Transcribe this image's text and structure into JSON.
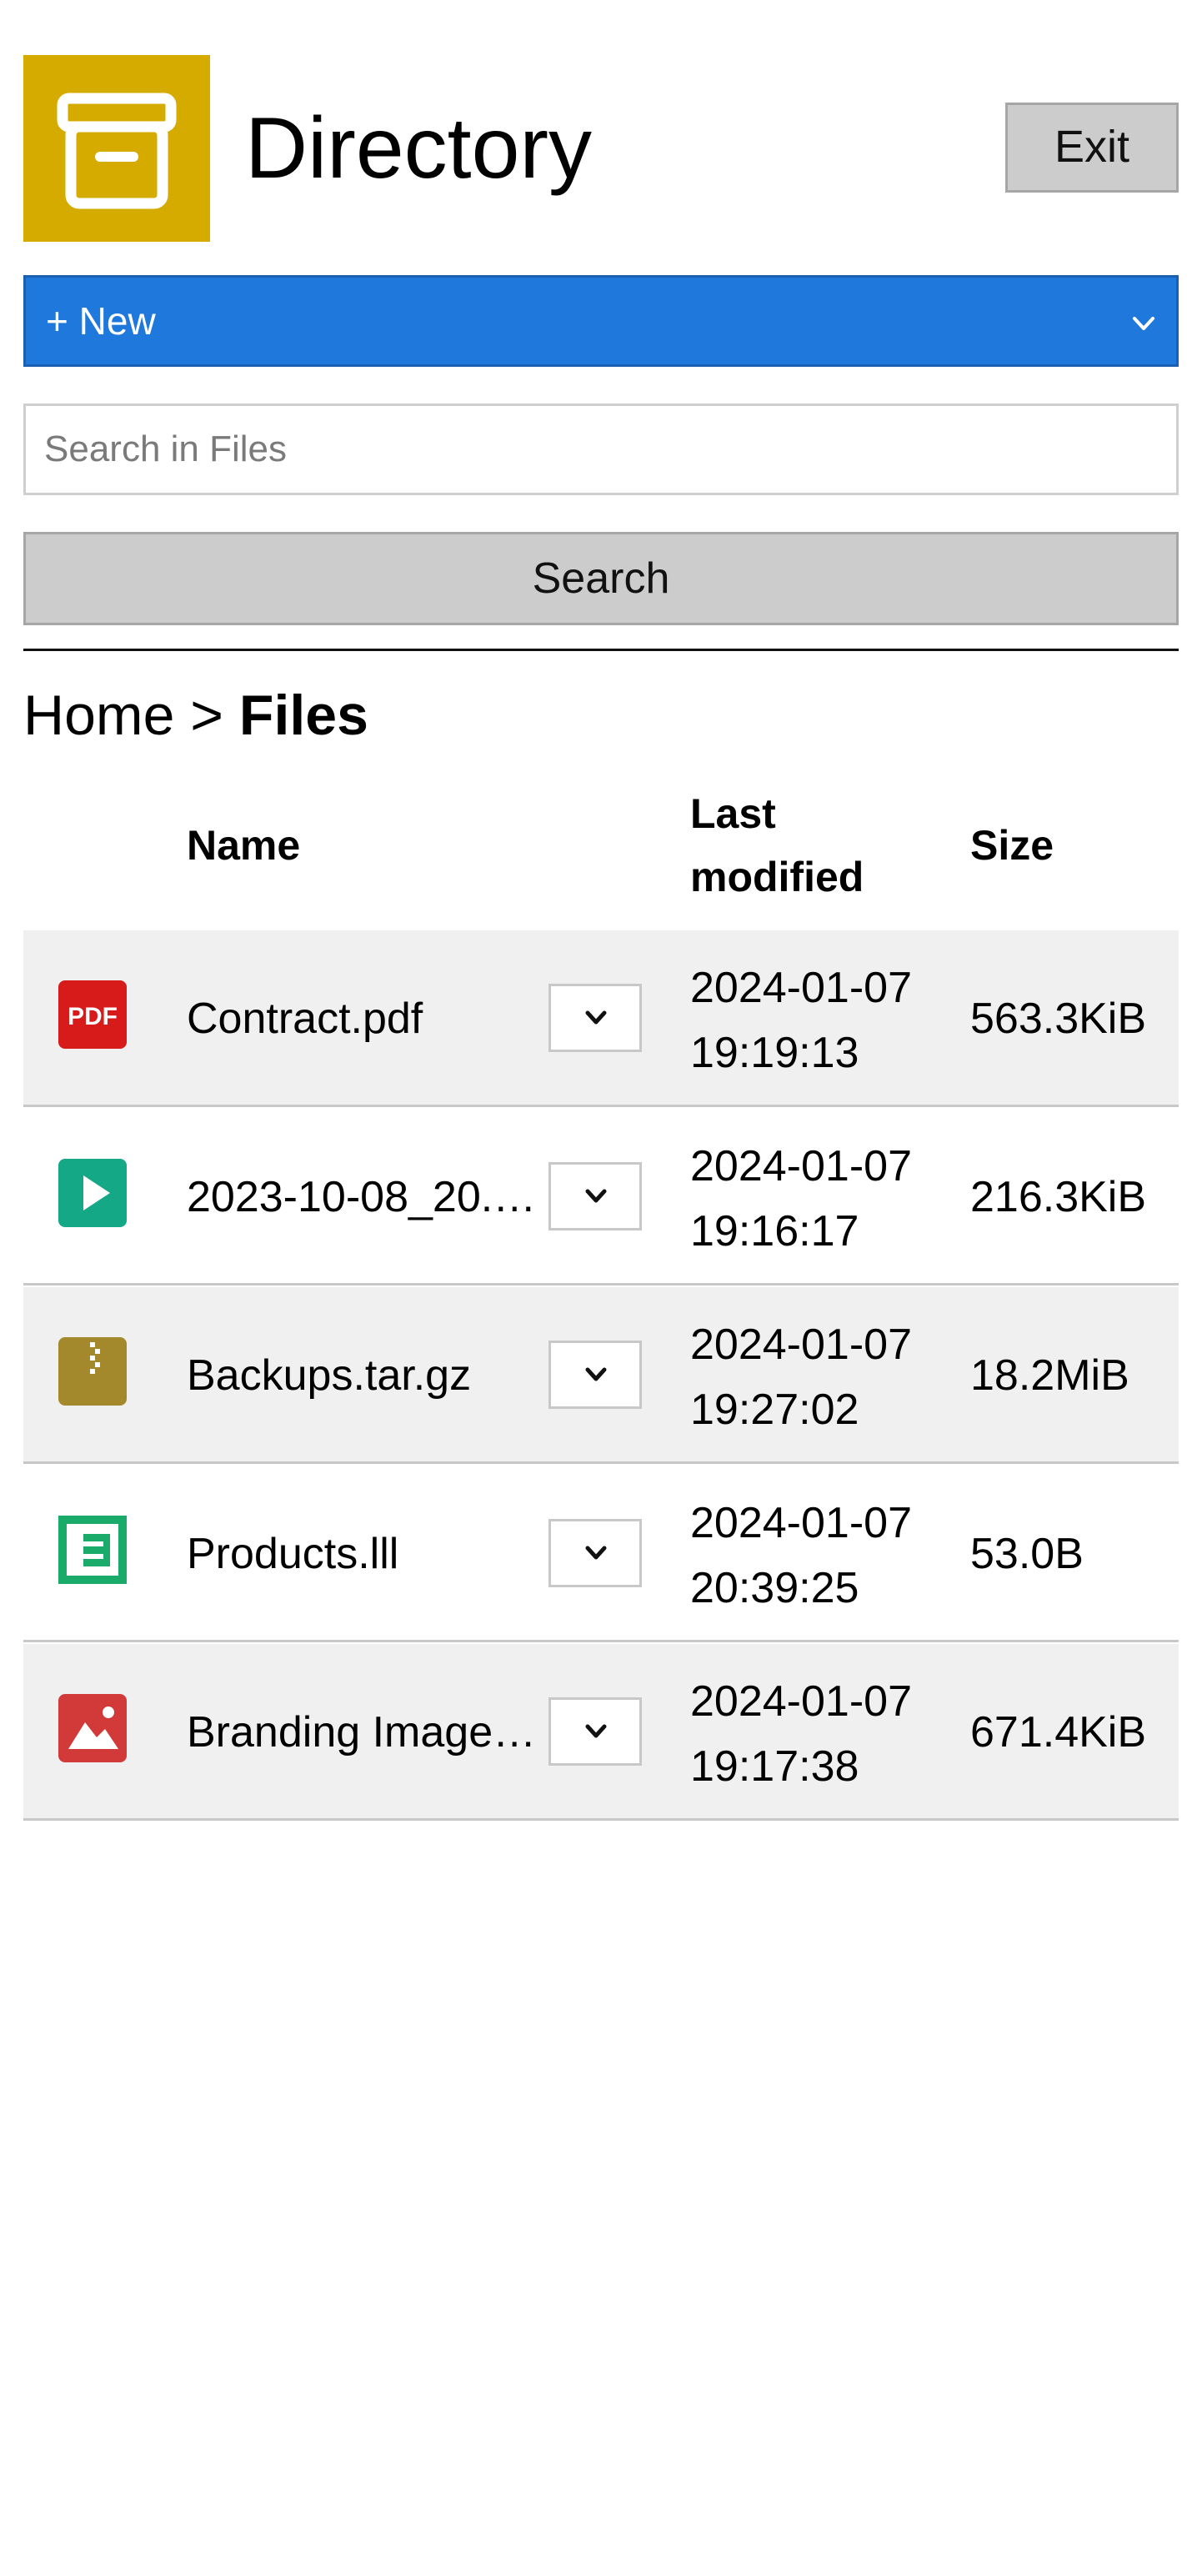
{
  "header": {
    "title": "Directory",
    "exit_label": "Exit",
    "logo_icon": "archive-box-icon",
    "logo_color": "#d6ab00"
  },
  "new_menu": {
    "selected": "+ New",
    "color": "#1f78dc"
  },
  "search": {
    "placeholder": "Search in Files",
    "value": "",
    "button_label": "Search"
  },
  "breadcrumb": {
    "home": "Home",
    "separator": ">",
    "current": "Files"
  },
  "table": {
    "columns": {
      "name": "Name",
      "modified_line1": "Last",
      "modified_line2": "modified",
      "size": "Size"
    },
    "rows": [
      {
        "icon": "pdf-icon",
        "name": "Contract.pdf",
        "date": "2024-01-07",
        "time": "19:19:13",
        "size": "563.3KiB"
      },
      {
        "icon": "video-play-icon",
        "name": "2023-10-08_20.…",
        "date": "2024-01-07",
        "time": "19:16:17",
        "size": "216.3KiB"
      },
      {
        "icon": "zip-archive-icon",
        "name": "Backups.tar.gz",
        "date": "2024-01-07",
        "time": "19:27:02",
        "size": "18.2MiB"
      },
      {
        "icon": "document-text-icon",
        "name": "Products.lll",
        "date": "2024-01-07",
        "time": "20:39:25",
        "size": "53.0B"
      },
      {
        "icon": "image-icon",
        "name": "Branding Image…",
        "date": "2024-01-07",
        "time": "19:17:38",
        "size": "671.4KiB"
      }
    ]
  }
}
